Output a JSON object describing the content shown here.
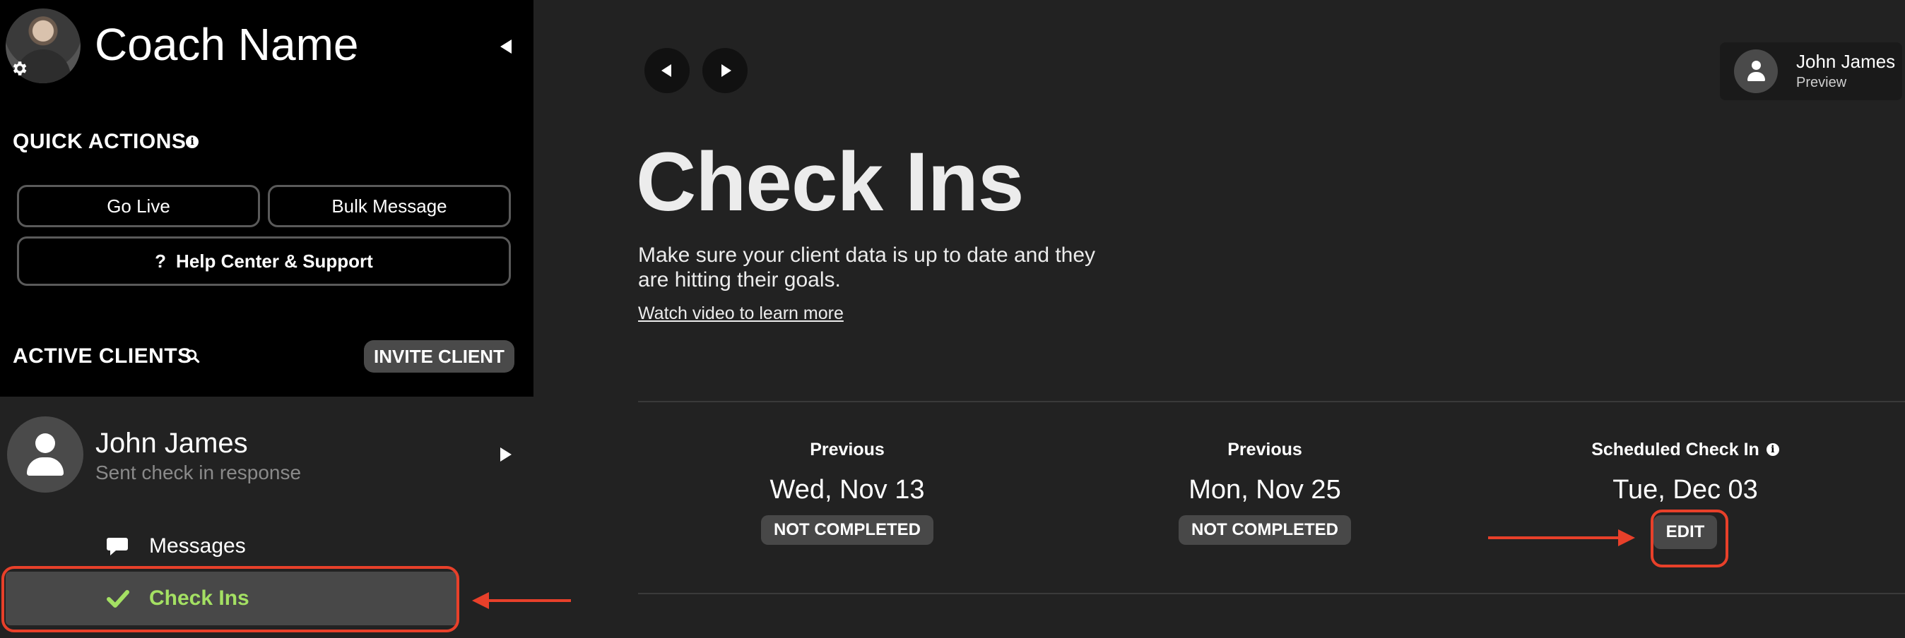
{
  "sidebar": {
    "coach_name": "Coach Name",
    "quick_actions_title": "QUICK ACTIONS",
    "go_live_label": "Go Live",
    "bulk_message_label": "Bulk Message",
    "help_icon": "?",
    "help_label": "Help Center & Support",
    "active_clients_title": "ACTIVE CLIENTS",
    "invite_client_label": "INVITE CLIENT",
    "client": {
      "name": "John James",
      "status": "Sent check in response"
    },
    "menu": [
      {
        "label": "Messages",
        "icon": "chat-bubble-icon"
      },
      {
        "label": "Check Ins",
        "icon": "checkmark-icon",
        "active": true
      }
    ]
  },
  "header": {
    "user_name": "John James",
    "user_subtitle": "Preview"
  },
  "main": {
    "title": "Check Ins",
    "description": "Make sure your client data is up to date and they are hitting their goals.",
    "video_link": "Watch video to learn more",
    "check_ins": [
      {
        "label": "Previous",
        "date": "Wed, Nov 13",
        "status": "NOT COMPLETED"
      },
      {
        "label": "Previous",
        "date": "Mon, Nov 25",
        "status": "NOT COMPLETED"
      },
      {
        "label": "Scheduled Check In",
        "date": "Tue, Dec 03",
        "action": "EDIT"
      }
    ]
  },
  "colors": {
    "background": "#222222",
    "sidebar_top": "#000000",
    "active_accent": "#a4e063",
    "annotation": "#e8402a",
    "badge": "#484848"
  }
}
